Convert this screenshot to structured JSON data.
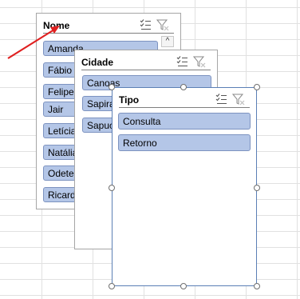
{
  "slicers": {
    "nome": {
      "title": "Nome",
      "items": [
        "Amanda",
        "Fábio",
        "Felipe",
        "Jair",
        "Letícia",
        "Natália",
        "Odete",
        "Ricardo"
      ],
      "scroll_up_glyph": "^"
    },
    "cidade": {
      "title": "Cidade",
      "items": [
        "Canoas",
        "Sapiranga",
        "Sapucaia"
      ]
    },
    "tipo": {
      "title": "Tipo",
      "items": [
        "Consulta",
        "Retorno"
      ]
    }
  },
  "icons": {
    "multi_select": "multi-select-icon",
    "clear_filter": "clear-filter-icon"
  },
  "colors": {
    "item_fill": "#b4c6e7",
    "item_border": "#7d93c0",
    "arrow": "#e02020",
    "selection_border": "#5b7fb5"
  }
}
